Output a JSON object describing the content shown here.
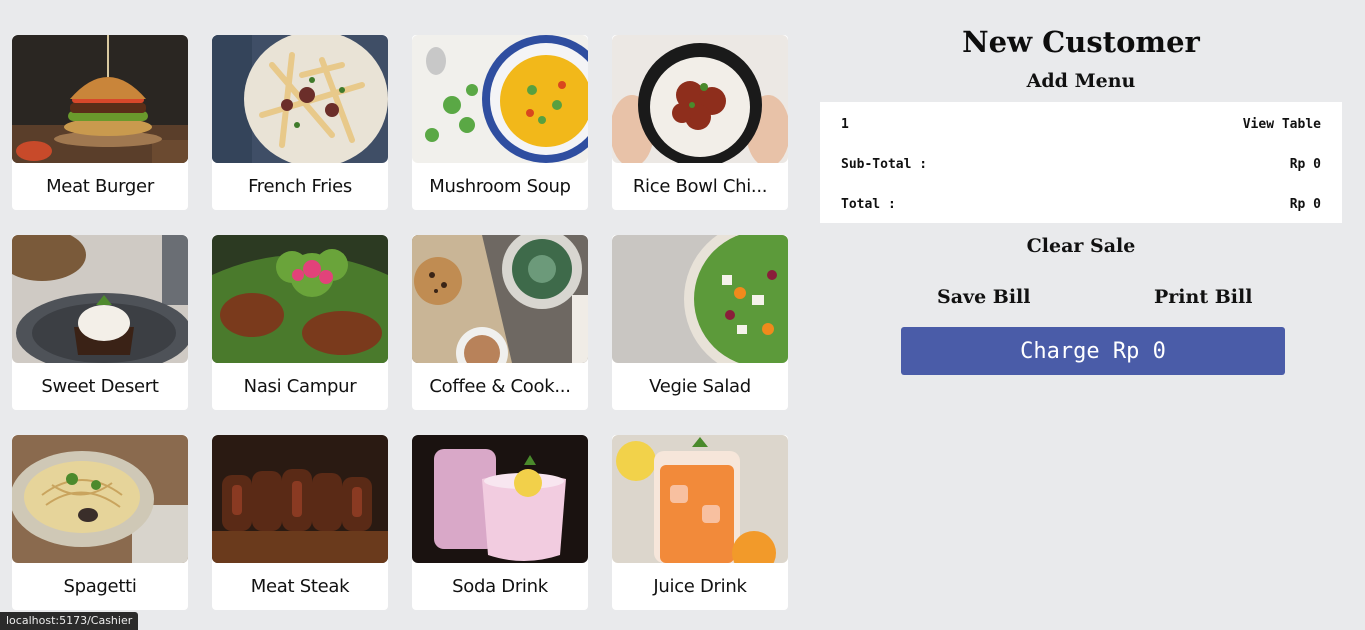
{
  "menu": {
    "items": [
      {
        "name": "Meat Burger"
      },
      {
        "name": "French Fries"
      },
      {
        "name": "Mushroom Soup"
      },
      {
        "name": "Rice Bowl Chi..."
      },
      {
        "name": "Sweet Desert"
      },
      {
        "name": "Nasi Campur"
      },
      {
        "name": "Coffee & Cook..."
      },
      {
        "name": "Vegie Salad"
      },
      {
        "name": "Spagetti"
      },
      {
        "name": "Meat Steak"
      },
      {
        "name": "Soda Drink"
      },
      {
        "name": "Juice Drink"
      }
    ]
  },
  "panel": {
    "title": "New Customer",
    "add_menu": "Add Menu",
    "table_number": "1",
    "view_table": "View Table",
    "subtotal_label": "Sub-Total :",
    "subtotal_value": "Rp 0",
    "total_label": "Total :",
    "total_value": "Rp 0",
    "clear_sale": "Clear Sale",
    "save_bill": "Save Bill",
    "print_bill": "Print Bill",
    "charge": "Charge Rp 0"
  },
  "status_bar": {
    "url": "localhost:5173/Cashier"
  },
  "colors": {
    "background": "#e9eaec",
    "charge_button": "#4a5ca8",
    "card": "#ffffff"
  }
}
